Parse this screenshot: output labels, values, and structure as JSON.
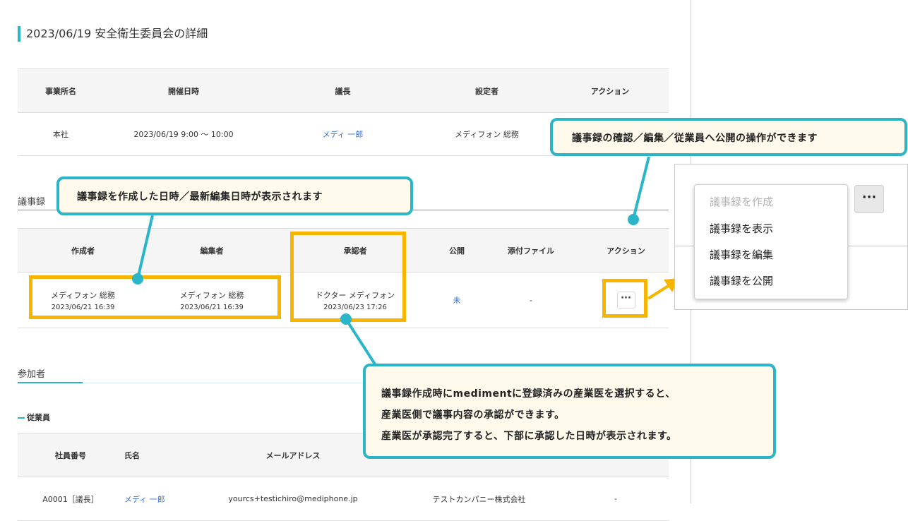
{
  "page": {
    "title": "2023/06/19 安全衛生委員会の詳細"
  },
  "meeting_table": {
    "headers": [
      "事業所名",
      "開催日時",
      "議長",
      "設定者",
      "アクション"
    ],
    "row": {
      "office": "本社",
      "datetime": "2023/06/19 9:00 〜 10:00",
      "chair": "メディ 一郎",
      "setter": "メディフォン 総務"
    }
  },
  "minutes": {
    "label": "議事録",
    "headers": [
      "作成者",
      "編集者",
      "承認者",
      "公開",
      "添付ファイル",
      "アクション"
    ],
    "row": {
      "creator_name": "メディフォン 総務",
      "creator_date": "2023/06/21 16:39",
      "editor_name": "メディフォン 総務",
      "editor_date": "2023/06/21 16:39",
      "approver_name": "ドクター メディフォン",
      "approver_date": "2023/06/23 17:26",
      "published": "未",
      "attachment": "-",
      "action_label": "···"
    }
  },
  "participants": {
    "label": "参加者",
    "sub_label": "従業員",
    "headers": [
      "社員番号",
      "氏名",
      "メールアドレス"
    ],
    "row": {
      "emp_no": "A0001［議長］",
      "name": "メディ 一郎",
      "email": "yourcs+testichiro@mediphone.jp",
      "company": "テストカンパニー株式会社",
      "action": "-"
    }
  },
  "callouts": {
    "top_right": "議事録の確認／編集／従業員へ公開の操作ができます",
    "minutes_dates": "議事録を作成した日時／最新編集日時が表示されます",
    "approver_lines": [
      "議事録作成時にmedimentに登録済みの産業医を選択すると、",
      "産業医側で議事内容の承認ができます。",
      "産業医が承認完了すると、下部に承認した日時が表示されます。"
    ]
  },
  "action_menu": {
    "button_label": "···",
    "items": [
      {
        "label": "議事録を作成",
        "enabled": false
      },
      {
        "label": "議事録を表示",
        "enabled": true
      },
      {
        "label": "議事録を編集",
        "enabled": true
      },
      {
        "label": "議事録を公開",
        "enabled": true
      }
    ]
  },
  "colors": {
    "accent": "#29b6c8",
    "highlight": "#f7b500",
    "callout_bg": "#fffaec",
    "link": "#3a6fd8"
  }
}
